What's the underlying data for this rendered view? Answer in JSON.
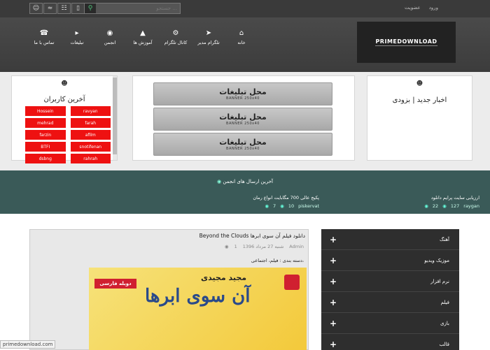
{
  "topbar": {
    "icons": [
      "user-icon",
      "rss-icon",
      "sitemap-icon",
      "mobile-icon"
    ],
    "search_placeholder": "جستجو ...",
    "links": [
      "ورود",
      "عضویت"
    ]
  },
  "nav": [
    {
      "label": "تماس با ما",
      "icon": "phone-icon"
    },
    {
      "label": "تبلیغات",
      "icon": "megaphone-icon"
    },
    {
      "label": "انجمن",
      "icon": "comments-icon"
    },
    {
      "label": "آموزش ها",
      "icon": "graduation-icon"
    },
    {
      "label": "کانال تلگرام",
      "icon": "cogs-icon"
    },
    {
      "label": "تلگرام مدیر",
      "icon": "paper-plane-icon"
    },
    {
      "label": "خانه",
      "icon": "home-icon"
    }
  ],
  "logo": "PRIMEDOWNLOAD",
  "users_panel": {
    "title": "آخرین کاربران",
    "users": [
      {
        "left": "Hossein",
        "right": "ravyan"
      },
      {
        "left": "mehrad",
        "right": "farah"
      },
      {
        "left": "farzin",
        "right": "afilm"
      },
      {
        "left": "BTFI",
        "right": "snotifenan"
      },
      {
        "left": "dsbng",
        "right": "rahrah"
      }
    ]
  },
  "ads": {
    "label": "محل تبلیغات",
    "sub": "BANNER 250x40"
  },
  "news_panel": {
    "title": "اخبار جدید | بزودی"
  },
  "forum": {
    "heading": "آخرین ارسال های انجمن",
    "posts": [
      {
        "title": "ارزیابی سایت پرایم دانلود",
        "author": "raygan",
        "replies": "127",
        "views": "22"
      },
      {
        "title": "پکیج عالی 700 مگابایت انواع رمان",
        "author": "piskervat",
        "replies": "10",
        "views": "7"
      }
    ]
  },
  "article": {
    "title": "دانلود فیلم آن سوی ابرها Beyond the Clouds",
    "author": "Admin",
    "date": "شنبه 27 مرداد 1396",
    "comments": "1",
    "category_label": "دسته بندی : فیلم، اجتماعی،",
    "image": {
      "badge": "دوبله فارسی",
      "director": "مجید مجیدی",
      "title": "آن سوی ابرها"
    }
  },
  "categories": [
    "آهنگ",
    "موزیک ویدیو",
    "نرم افزار",
    "فیلم",
    "بازی",
    "قالب"
  ],
  "status_url": "primedownload.com",
  "colors": {
    "topbar": "#3a3a3a",
    "accent_red": "#e11111",
    "forum_bg": "#3a5a58",
    "search_accent": "#4fc37a"
  }
}
